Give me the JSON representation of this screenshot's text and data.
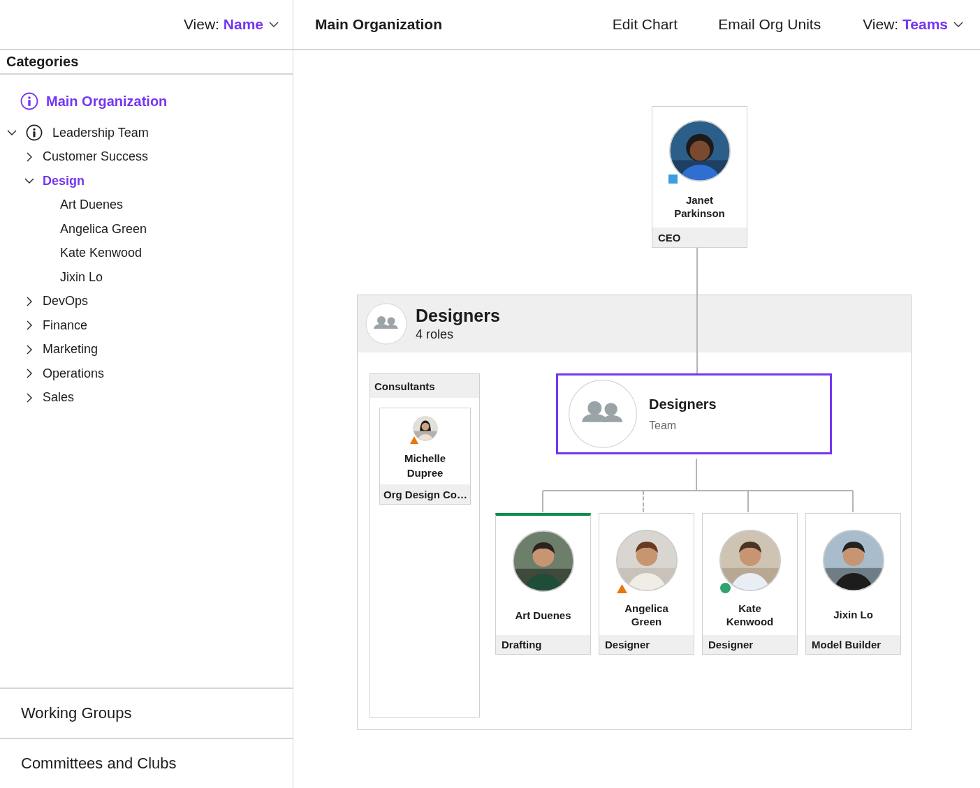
{
  "sidebar": {
    "view": {
      "label": "View:",
      "value": "Name"
    },
    "heading": "Categories",
    "root": {
      "label": "Main Organization",
      "selected": true
    },
    "tree": [
      {
        "label": "Leadership Team",
        "info": true,
        "expanded": true,
        "selected": false,
        "children": [
          {
            "label": "Customer Success",
            "expanded": false,
            "selected": false
          },
          {
            "label": "Design",
            "expanded": true,
            "selected": true,
            "children": [
              {
                "label": "Art Duenes",
                "selected": false
              },
              {
                "label": "Angelica Green",
                "selected": false
              },
              {
                "label": "Kate Kenwood",
                "selected": false
              },
              {
                "label": "Jixin Lo",
                "selected": false
              }
            ]
          },
          {
            "label": "DevOps",
            "expanded": false,
            "selected": false
          },
          {
            "label": "Finance",
            "expanded": false,
            "selected": false
          },
          {
            "label": "Marketing",
            "expanded": false,
            "selected": false
          },
          {
            "label": "Operations",
            "expanded": false,
            "selected": false
          },
          {
            "label": "Sales",
            "expanded": false,
            "selected": false
          }
        ]
      }
    ],
    "sections": [
      "Working Groups",
      "Committees and Clubs"
    ]
  },
  "header": {
    "title": "Main Organization",
    "actions": [
      "Edit Chart",
      "Email Org Units"
    ],
    "view": {
      "label": "View:",
      "value": "Teams"
    }
  },
  "chart": {
    "head": {
      "name": "Janet Parkinson",
      "role": "CEO",
      "status": {
        "kind": "square",
        "color": "#3a9ee0"
      }
    },
    "group": {
      "title": "Designers",
      "subtitle": "4 roles",
      "side_panel": {
        "title": "Consultants",
        "members": [
          {
            "name": "Michelle Dupree",
            "role": "Org Design Co…",
            "status": {
              "kind": "triangle",
              "color": "#e8760f"
            }
          }
        ]
      },
      "team": {
        "title": "Designers",
        "subtitle": "Team",
        "selected": true
      },
      "members": [
        {
          "name": "Art Duenes",
          "role": "Drafting",
          "selected": true,
          "dashed": false
        },
        {
          "name": "Angelica Green",
          "role": "Designer",
          "selected": false,
          "dashed": true,
          "status": {
            "kind": "triangle",
            "color": "#e8760f"
          }
        },
        {
          "name": "Kate Kenwood",
          "role": "Designer",
          "selected": false,
          "dashed": false,
          "status": {
            "kind": "dot",
            "color": "#2fa36b"
          }
        },
        {
          "name": "Jixin Lo",
          "role": "Model Builder",
          "selected": false,
          "dashed": false
        }
      ]
    }
  }
}
